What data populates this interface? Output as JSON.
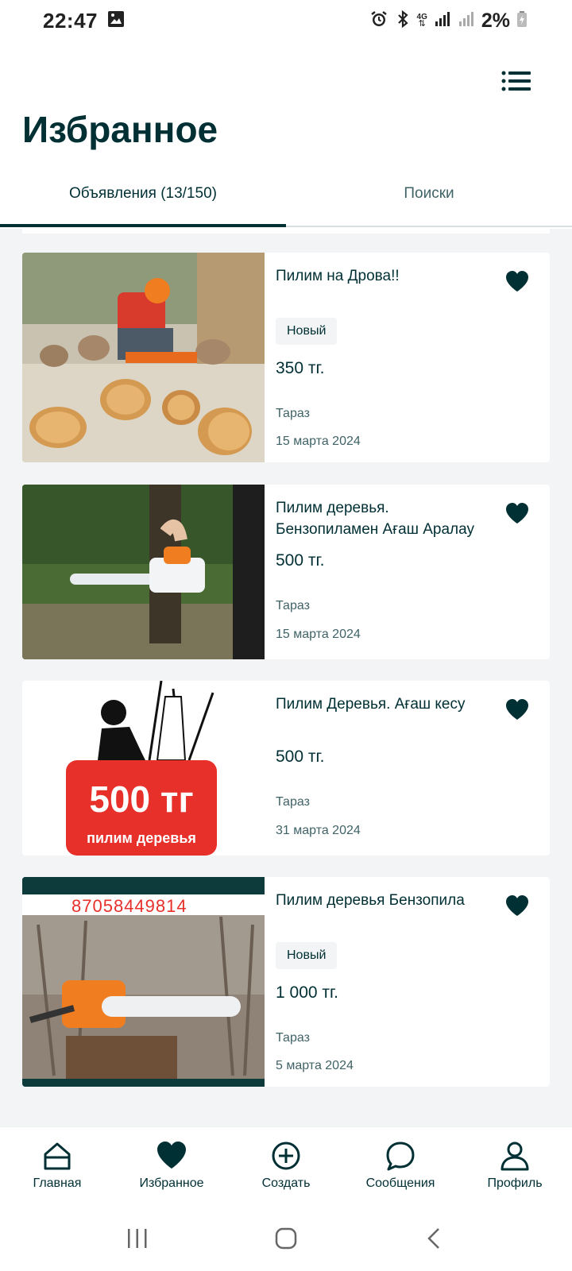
{
  "status_bar": {
    "time": "22:47",
    "network": "4G",
    "battery": "2%"
  },
  "header": {
    "title": "Избранное",
    "menu_icon": "list-menu-icon"
  },
  "tabs": [
    {
      "label": "Объявления (13/150)",
      "active": true
    },
    {
      "label": "Поиски",
      "active": false
    }
  ],
  "listings": [
    {
      "title": "Пилим на Дрова!!",
      "badge": "Новый",
      "price": "350 тг.",
      "city": "Тараз",
      "date": "15 марта 2024",
      "image": "chainsaw-firewood-photo"
    },
    {
      "title": "Пилим деревья. Бензопиламен Ағаш Аралау",
      "badge": "",
      "price": "500 тг.",
      "city": "Тараз",
      "date": "15 марта 2024",
      "image": "chainsaw-cutting-tree-photo"
    },
    {
      "title": "Пилим Деревья. Ағаш кесу",
      "badge": "",
      "price": "500 тг.",
      "city": "Тараз",
      "date": "31 марта 2024",
      "image": "tree-cutting-ad-graphic",
      "image_text_big": "500 тг",
      "image_text_small": "пилим деревья"
    },
    {
      "title": "Пилим деревья Бензопила",
      "badge": "Новый",
      "price": "1 000 тг.",
      "city": "Тараз",
      "date": "5 марта 2024",
      "image": "chainsaw-on-stump-photo",
      "image_phone": "87058449814"
    }
  ],
  "bottom_nav": [
    {
      "label": "Главная",
      "icon": "home-icon"
    },
    {
      "label": "Избранное",
      "icon": "heart-icon",
      "active": true
    },
    {
      "label": "Создать",
      "icon": "plus-circle-icon"
    },
    {
      "label": "Сообщения",
      "icon": "chat-bubble-icon"
    },
    {
      "label": "Профиль",
      "icon": "user-icon"
    }
  ],
  "colors": {
    "primary": "#002f34",
    "background": "#f2f4f5",
    "secondary_text": "#406367"
  }
}
